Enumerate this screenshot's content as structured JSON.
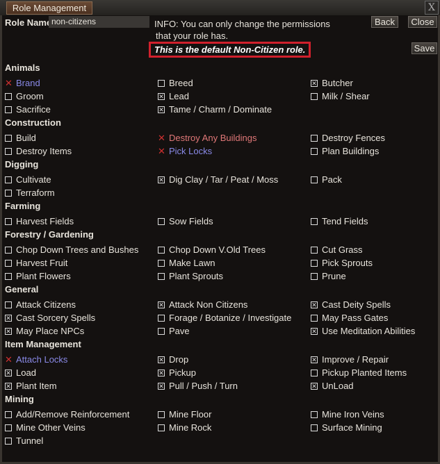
{
  "window": {
    "title": "Role Management",
    "close": "X"
  },
  "role": {
    "label": "Role Name",
    "value": "non-citizens"
  },
  "info": {
    "line1": "INFO: You can only change the permissions",
    "line2": "that your role has.",
    "default_notice": "This is the default Non-Citizen role."
  },
  "buttons": {
    "back": "Back",
    "close": "Close",
    "save": "Save"
  },
  "colors": {
    "deny_mark": "#d03030",
    "blue_label": "#8a8ae8",
    "red_label": "#e07878",
    "notice_border": "#d0202c"
  },
  "sections": [
    {
      "title": "Animals",
      "items": [
        {
          "label": "Brand",
          "state": "denied",
          "color": "blue"
        },
        {
          "label": "Breed",
          "state": "unchecked"
        },
        {
          "label": "Butcher",
          "state": "checked"
        },
        {
          "label": "Groom",
          "state": "unchecked"
        },
        {
          "label": "Lead",
          "state": "checked"
        },
        {
          "label": "Milk / Shear",
          "state": "unchecked"
        },
        {
          "label": "Sacrifice",
          "state": "unchecked"
        },
        {
          "label": "Tame / Charm / Dominate",
          "state": "checked"
        }
      ]
    },
    {
      "title": "Construction",
      "items": [
        {
          "label": "Build",
          "state": "unchecked"
        },
        {
          "label": "Destroy Any Buildings",
          "state": "denied",
          "color": "red"
        },
        {
          "label": "Destroy Fences",
          "state": "unchecked"
        },
        {
          "label": "Destroy Items",
          "state": "unchecked"
        },
        {
          "label": "Pick Locks",
          "state": "denied",
          "color": "blue"
        },
        {
          "label": "Plan Buildings",
          "state": "unchecked"
        }
      ]
    },
    {
      "title": "Digging",
      "items": [
        {
          "label": "Cultivate",
          "state": "unchecked"
        },
        {
          "label": "Dig Clay / Tar / Peat / Moss",
          "state": "checked"
        },
        {
          "label": "Pack",
          "state": "unchecked"
        },
        {
          "label": "Terraform",
          "state": "unchecked"
        }
      ]
    },
    {
      "title": "Farming",
      "items": [
        {
          "label": "Harvest Fields",
          "state": "unchecked"
        },
        {
          "label": "Sow Fields",
          "state": "unchecked"
        },
        {
          "label": "Tend Fields",
          "state": "unchecked"
        }
      ]
    },
    {
      "title": "Forestry / Gardening",
      "items": [
        {
          "label": "Chop Down Trees and Bushes",
          "state": "unchecked"
        },
        {
          "label": "Chop Down V.Old Trees",
          "state": "unchecked"
        },
        {
          "label": "Cut Grass",
          "state": "unchecked"
        },
        {
          "label": "Harvest Fruit",
          "state": "unchecked"
        },
        {
          "label": "Make Lawn",
          "state": "unchecked"
        },
        {
          "label": "Pick Sprouts",
          "state": "unchecked"
        },
        {
          "label": "Plant Flowers",
          "state": "unchecked"
        },
        {
          "label": "Plant Sprouts",
          "state": "unchecked"
        },
        {
          "label": "Prune",
          "state": "unchecked"
        }
      ]
    },
    {
      "title": "General",
      "items": [
        {
          "label": "Attack Citizens",
          "state": "unchecked"
        },
        {
          "label": "Attack Non Citizens",
          "state": "checked"
        },
        {
          "label": "Cast Deity Spells",
          "state": "checked"
        },
        {
          "label": "Cast Sorcery Spells",
          "state": "checked"
        },
        {
          "label": "Forage / Botanize / Investigate",
          "state": "unchecked"
        },
        {
          "label": "May Pass Gates",
          "state": "unchecked"
        },
        {
          "label": "May Place NPCs",
          "state": "checked"
        },
        {
          "label": "Pave",
          "state": "unchecked"
        },
        {
          "label": "Use Meditation Abilities",
          "state": "checked"
        }
      ]
    },
    {
      "title": "Item Management",
      "items": [
        {
          "label": "Attach Locks",
          "state": "denied",
          "color": "blue"
        },
        {
          "label": "Drop",
          "state": "checked"
        },
        {
          "label": "Improve / Repair",
          "state": "checked"
        },
        {
          "label": "Load",
          "state": "checked"
        },
        {
          "label": "Pickup",
          "state": "checked"
        },
        {
          "label": "Pickup Planted Items",
          "state": "unchecked"
        },
        {
          "label": "Plant Item",
          "state": "checked"
        },
        {
          "label": "Pull / Push / Turn",
          "state": "checked"
        },
        {
          "label": "UnLoad",
          "state": "checked"
        }
      ]
    },
    {
      "title": "Mining",
      "items": [
        {
          "label": "Add/Remove Reinforcement",
          "state": "unchecked"
        },
        {
          "label": "Mine Floor",
          "state": "unchecked"
        },
        {
          "label": "Mine Iron Veins",
          "state": "unchecked"
        },
        {
          "label": "Mine Other Veins",
          "state": "unchecked"
        },
        {
          "label": "Mine Rock",
          "state": "unchecked"
        },
        {
          "label": "Surface Mining",
          "state": "unchecked"
        },
        {
          "label": "Tunnel",
          "state": "unchecked"
        }
      ]
    }
  ]
}
